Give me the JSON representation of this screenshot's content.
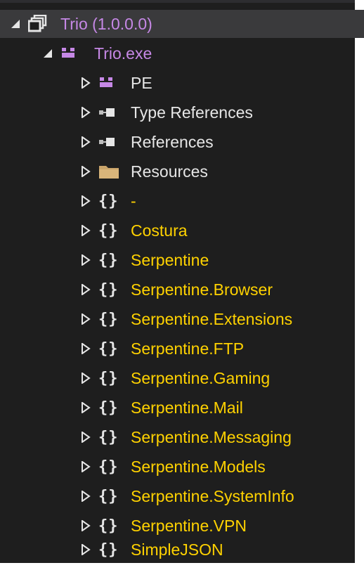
{
  "tree": {
    "root": {
      "label": "Trio (1.0.0.0)",
      "icon": "assembly-icon",
      "expanded": true
    },
    "module": {
      "label": "Trio.exe",
      "icon": "module-icon",
      "expanded": true
    },
    "children": [
      {
        "label": "PE",
        "icon": "pe-icon",
        "type": "pe"
      },
      {
        "label": "Type References",
        "icon": "reference-icon",
        "type": "ref"
      },
      {
        "label": "References",
        "icon": "reference-icon",
        "type": "ref"
      },
      {
        "label": "Resources",
        "icon": "folder-icon",
        "type": "folder"
      },
      {
        "label": "-",
        "icon": "namespace-icon",
        "type": "ns-empty"
      },
      {
        "label": "Costura",
        "icon": "namespace-icon",
        "type": "ns"
      },
      {
        "label": "Serpentine",
        "icon": "namespace-icon",
        "type": "ns"
      },
      {
        "label": "Serpentine.Browser",
        "icon": "namespace-icon",
        "type": "ns"
      },
      {
        "label": "Serpentine.Extensions",
        "icon": "namespace-icon",
        "type": "ns"
      },
      {
        "label": "Serpentine.FTP",
        "icon": "namespace-icon",
        "type": "ns"
      },
      {
        "label": "Serpentine.Gaming",
        "icon": "namespace-icon",
        "type": "ns"
      },
      {
        "label": "Serpentine.Mail",
        "icon": "namespace-icon",
        "type": "ns"
      },
      {
        "label": "Serpentine.Messaging",
        "icon": "namespace-icon",
        "type": "ns"
      },
      {
        "label": "Serpentine.Models",
        "icon": "namespace-icon",
        "type": "ns"
      },
      {
        "label": "Serpentine.SystemInfo",
        "icon": "namespace-icon",
        "type": "ns"
      },
      {
        "label": "Serpentine.VPN",
        "icon": "namespace-icon",
        "type": "ns"
      },
      {
        "label": "SimpleJSON",
        "icon": "namespace-icon",
        "type": "ns"
      }
    ]
  },
  "colors": {
    "background": "#1e1e1e",
    "selected_row": "#3a3a3c",
    "assembly_text": "#c688e6",
    "module_text": "#c688e6",
    "namespace_text": "#ffd200",
    "default_text": "#e6e6e6",
    "module_icon": "#c688e6",
    "folder_icon": "#c9a46a"
  }
}
